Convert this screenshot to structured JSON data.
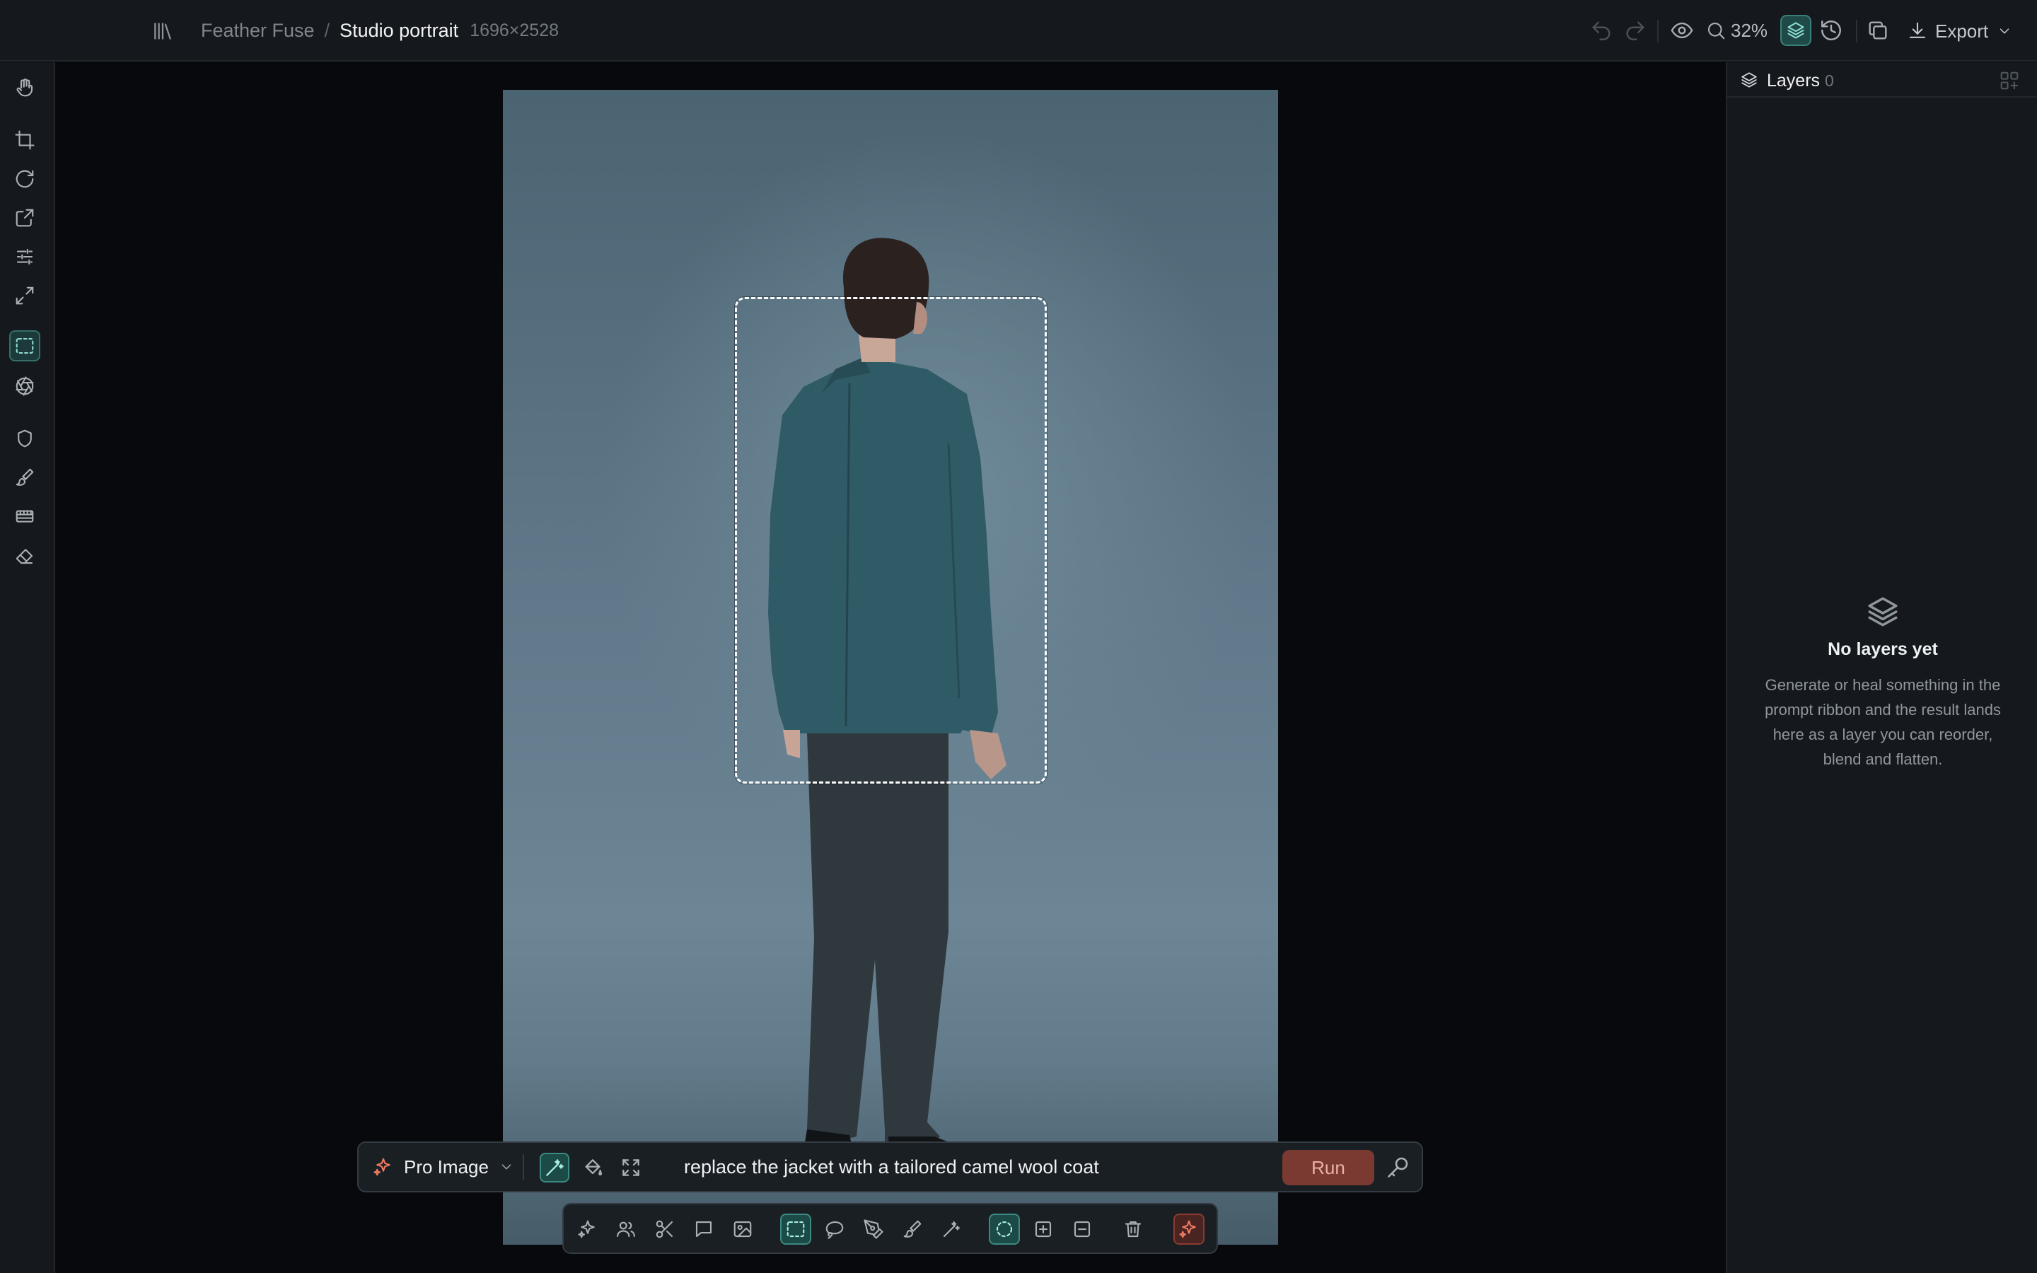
{
  "header": {
    "project": "Feather Fuse",
    "separator": "/",
    "document": "Studio portrait",
    "dimensions": "1696×2528",
    "zoom": "32%",
    "export_label": "Export"
  },
  "left_toolbar": {
    "tools": [
      "hand-icon",
      "crop-icon",
      "rotate-icon",
      "resize-icon",
      "adjust-icon",
      "expand-icon",
      "marquee-select-icon",
      "aperture-icon",
      "shield-icon",
      "brush-icon",
      "film-icon",
      "eraser-icon"
    ],
    "active_tool": "marquee-select-icon"
  },
  "prompt_ribbon": {
    "model": "Pro Image",
    "prompt": "replace the jacket with a tailored camel wool coat",
    "run_label": "Run"
  },
  "tool_dock": {
    "tools": [
      "sparkles-icon",
      "people-icon",
      "scissors-icon",
      "comment-icon",
      "image-icon",
      "rect-select-icon",
      "lasso-icon",
      "pen-icon",
      "brush-icon",
      "magic-wand-icon",
      "circle-select-icon",
      "add-selection-icon",
      "subtract-selection-icon",
      "trash-icon",
      "sparkle-accent-icon"
    ]
  },
  "layers_panel": {
    "title": "Layers",
    "count": "0",
    "empty_title": "No layers yet",
    "empty_body": "Generate or heal something in the prompt ribbon and the result lands here as a layer you can reorder, blend and flatten."
  },
  "colors": {
    "accent_teal": "#3d8a82",
    "accent_red": "#ef7a62",
    "run_button": "#7a3a31",
    "background": "#07090c",
    "panel": "#15181c"
  }
}
